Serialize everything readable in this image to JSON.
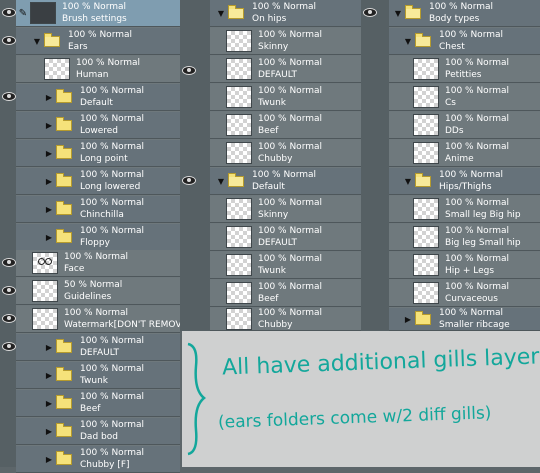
{
  "col1": {
    "header": {
      "mode": "100 % Normal",
      "name": "Brush settings"
    },
    "ears": {
      "mode": "100 % Normal",
      "name": "Ears"
    },
    "human": {
      "mode": "100 % Normal",
      "name": "Human"
    },
    "ears_sub": [
      {
        "mode": "100 % Normal",
        "name": "Default"
      },
      {
        "mode": "100 % Normal",
        "name": "Lowered"
      },
      {
        "mode": "100 % Normal",
        "name": "Long point"
      },
      {
        "mode": "100 % Normal",
        "name": "Long lowered"
      },
      {
        "mode": "100 % Normal",
        "name": "Chinchilla"
      },
      {
        "mode": "100 % Normal",
        "name": "Floppy"
      }
    ],
    "face": {
      "mode": "100 % Normal",
      "name": "Face"
    },
    "guides": {
      "mode": "50 % Normal",
      "name": "Guidelines"
    },
    "watermark": {
      "mode": "100 % Normal",
      "name": "Watermark[DON'T REMOVE]"
    },
    "bodies": [
      {
        "mode": "100 % Normal",
        "name": "DEFAULT"
      },
      {
        "mode": "100 % Normal",
        "name": "Twunk"
      },
      {
        "mode": "100 % Normal",
        "name": "Beef"
      },
      {
        "mode": "100 % Normal",
        "name": "Dad bod"
      },
      {
        "mode": "100 % Normal",
        "name": "Chubby [F]"
      }
    ]
  },
  "col2": {
    "hips": {
      "mode": "100 % Normal",
      "name": "On hips"
    },
    "hips_items": [
      {
        "mode": "100 % Normal",
        "name": "Skinny"
      },
      {
        "mode": "100 % Normal",
        "name": "DEFAULT"
      },
      {
        "mode": "100 % Normal",
        "name": "Twunk"
      },
      {
        "mode": "100 % Normal",
        "name": "Beef"
      },
      {
        "mode": "100 % Normal",
        "name": "Chubby"
      }
    ],
    "default": {
      "mode": "100 % Normal",
      "name": "Default"
    },
    "default_items": [
      {
        "mode": "100 % Normal",
        "name": "Skinny"
      },
      {
        "mode": "100 % Normal",
        "name": "DEFAULT"
      },
      {
        "mode": "100 % Normal",
        "name": "Twunk"
      },
      {
        "mode": "100 % Normal",
        "name": "Beef"
      },
      {
        "mode": "100 % Normal",
        "name": "Chubby"
      }
    ]
  },
  "col3": {
    "body": {
      "mode": "100 % Normal",
      "name": "Body types"
    },
    "chest": {
      "mode": "100 % Normal",
      "name": "Chest"
    },
    "chest_items": [
      {
        "mode": "100 % Normal",
        "name": "Petitties"
      },
      {
        "mode": "100 % Normal",
        "name": "Cs"
      },
      {
        "mode": "100 % Normal",
        "name": "DDs"
      },
      {
        "mode": "100 % Normal",
        "name": "Anime"
      }
    ],
    "hips": {
      "mode": "100 % Normal",
      "name": "Hips/Thighs"
    },
    "hips_items": [
      {
        "mode": "100 % Normal",
        "name": "Small leg Big hip"
      },
      {
        "mode": "100 % Normal",
        "name": "Big leg Small hip"
      },
      {
        "mode": "100 % Normal",
        "name": "Hip + Legs"
      },
      {
        "mode": "100 % Normal",
        "name": "Curvaceous"
      }
    ],
    "ribcage": {
      "mode": "100 % Normal",
      "name": "Smaller ribcage"
    }
  },
  "annotation": {
    "line1": "All have additional gills layer",
    "line2": "(ears folders come w/2 diff gills)",
    "color": "#13a79b"
  }
}
